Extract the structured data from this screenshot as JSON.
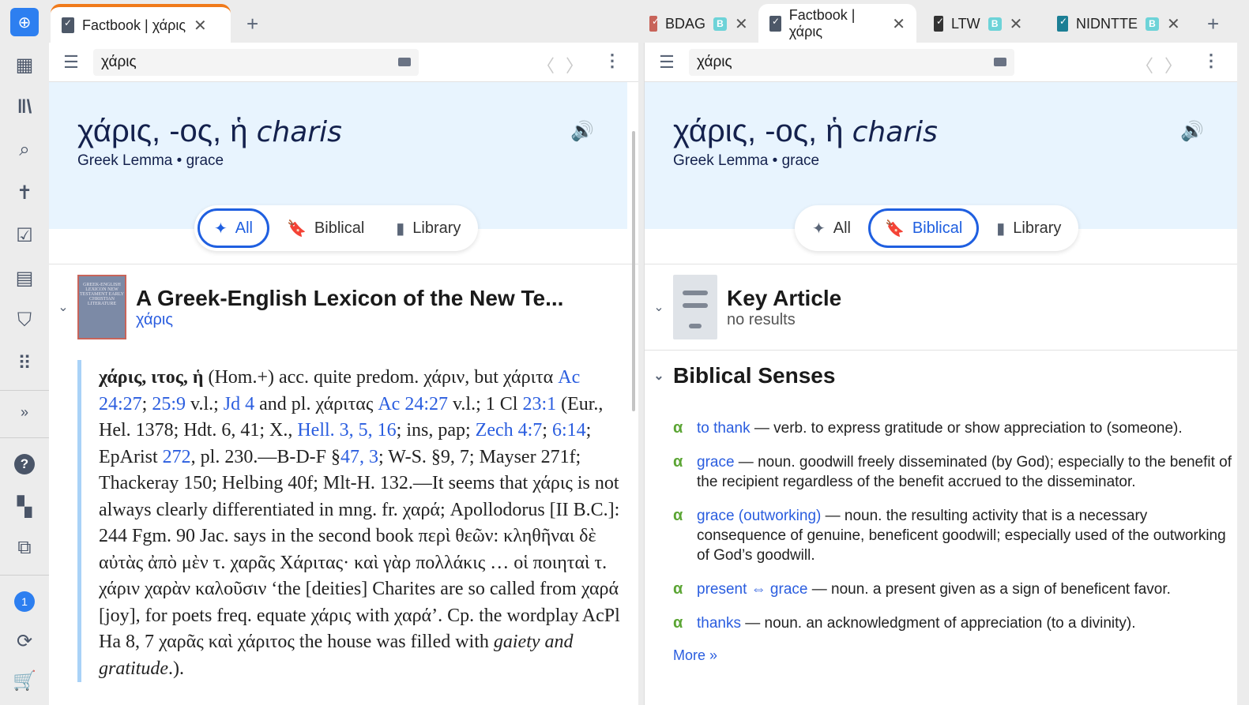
{
  "sidebar": {
    "items": [
      "logo",
      "dashboard-add",
      "library",
      "search",
      "bible",
      "factbook",
      "document",
      "shield",
      "apps",
      "expand",
      "help",
      "layout",
      "export",
      "notifications",
      "sync",
      "cart"
    ],
    "notification_count": "1",
    "expand_label": "»"
  },
  "left_tabs": [
    {
      "label": "Factbook | χάρις",
      "close": "✕"
    }
  ],
  "new_tab": "+",
  "right_tabs": [
    {
      "label": "BDAG",
      "badge": "B",
      "close": "✕"
    },
    {
      "label": "Factbook | χάρις",
      "close": "✕"
    },
    {
      "label": "LTW",
      "badge": "B",
      "close": "✕"
    },
    {
      "label": "NIDNTTE",
      "badge": "B",
      "close": "✕"
    }
  ],
  "accent": "#1f5fe0",
  "left": {
    "search": "χάρις",
    "lemma": "χάρις, -ος, ἡ",
    "translit": "charis",
    "lemma_type": "Greek Lemma",
    "gloss": "grace",
    "dot": "•",
    "filters": [
      "All",
      "Biblical",
      "Library"
    ],
    "result_title": "A Greek-English Lexicon of the New Te...",
    "result_sub": "χάρις",
    "cover_text": "GREEK-ENGLISH LEXICON NEW TESTAMENT EARLY CHRISTIAN LITERATURE",
    "entry": [
      {
        "t": "χάρις, ιτος, ἡ",
        "b": 1
      },
      {
        "t": " (Hom.+) acc. quite predom. χάριν, but χάριτα "
      },
      {
        "t": "Ac 24:27",
        "l": 1
      },
      {
        "t": "; "
      },
      {
        "t": "25:9",
        "l": 1
      },
      {
        "t": " v.l.; "
      },
      {
        "t": "Jd 4",
        "l": 1
      },
      {
        "t": " and pl. χάριτας "
      },
      {
        "t": "Ac 24:27",
        "l": 1
      },
      {
        "t": " v.l.; 1 Cl "
      },
      {
        "t": "23:1",
        "l": 1
      },
      {
        "t": " (Eur., Hel. 1378; Hdt. 6, 41; X., "
      },
      {
        "t": "Hell. 3, 5, 16",
        "l": 1
      },
      {
        "t": "; ins, pap; "
      },
      {
        "t": "Zech 4:7",
        "l": 1
      },
      {
        "t": "; "
      },
      {
        "t": "6:14",
        "l": 1
      },
      {
        "t": "; EpArist "
      },
      {
        "t": "272",
        "l": 1
      },
      {
        "t": ", pl. 230.—B-D-F §"
      },
      {
        "t": "47, 3",
        "l": 1
      },
      {
        "t": "; W-S. §9, 7; Mayser 271f; Thackeray 150; Helbing 40f; Mlt-H. 132.—It seems that χάρις is not always clearly differentiated in mng. fr. χαρά; Apollodorus [II B.C.]: 244 Fgm. 90 Jac. says in the second book περὶ θεῶν: κληθῆναι δὲ αὐτὰς ἀπὸ μὲν τ. χαρᾶς Χάριτας· καὶ γὰρ πολλάκις … οἱ ποιηταὶ τ. χάριν χαρὰν καλοῦσιν ‘the [deities] Charites are so called from χαρά [joy], for poets freq. equate χάρις with χαρά’. Cp. the wordplay AcPl Ha 8, 7 χαρᾶς καὶ χάριτος the house was filled with "
      },
      {
        "t": "gaiety and gratitude",
        "i": 1
      },
      {
        "t": ".)."
      }
    ]
  },
  "right": {
    "search": "χάρις",
    "lemma": "χάρις, -ος, ἡ",
    "translit": "charis",
    "lemma_type": "Greek Lemma",
    "gloss": "grace",
    "dot": "•",
    "filters": [
      "All",
      "Biblical",
      "Library"
    ],
    "key_title": "Key Article",
    "key_sub": "no results",
    "senses_title": "Biblical Senses",
    "senses": [
      {
        "term": "to thank",
        "def": " — verb. to express gratitude or show appreciation to (someone)."
      },
      {
        "term": "grace",
        "def": " — noun. goodwill freely disseminated (by God); especially to the benefit of the recipient regardless of the benefit accrued to the disseminator."
      },
      {
        "term": "grace (outworking)",
        "def": " — noun. the resulting activity that is a necessary consequence of genuine, beneficent goodwill; especially used of the outworking of God’s goodwill."
      },
      {
        "term": "present ⇔ grace",
        "def": " — noun. a present given as a sign of beneficent favor."
      },
      {
        "term": "thanks",
        "def": " — noun. an acknowledgment of appreciation (to a divinity)."
      }
    ],
    "more": "More »"
  }
}
